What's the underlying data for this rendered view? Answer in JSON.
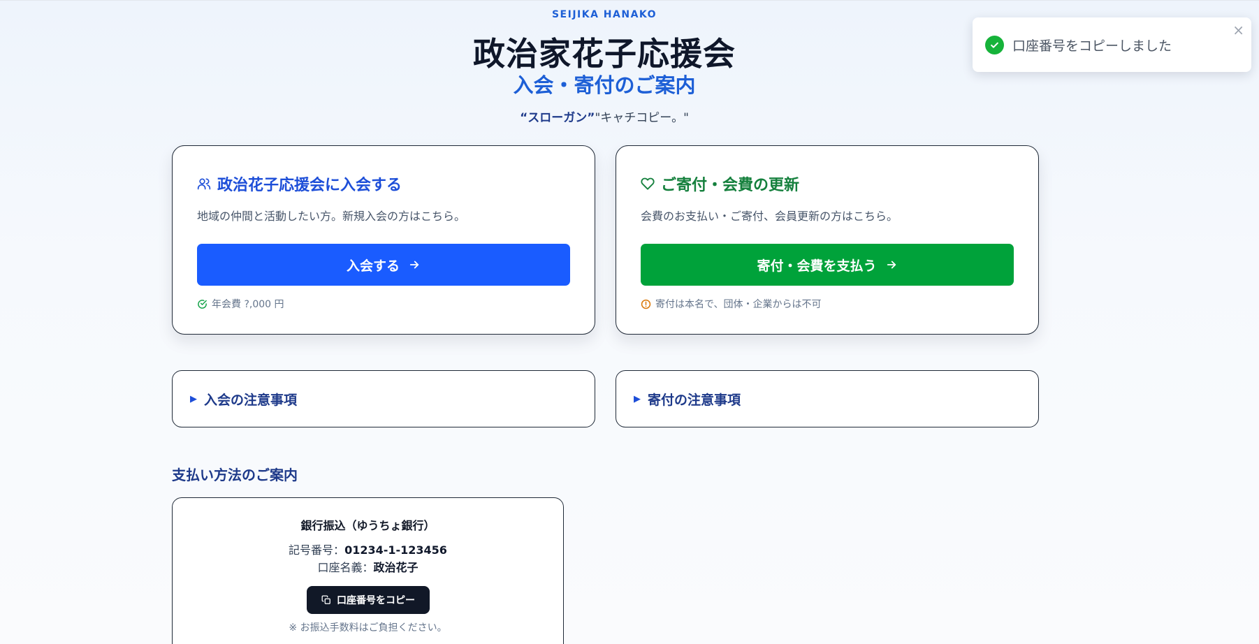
{
  "header": {
    "eyebrow": "SEIJIKA HANAKO",
    "title": "政治家花子応援会",
    "subtitle": "入会・寄付のご案内",
    "slogan_bold": "“スローガン”",
    "slogan_rest": "\"キャチコピー。\""
  },
  "cards": {
    "join": {
      "icon": "users-icon",
      "heading": "政治花子応援会に入会する",
      "description": "地域の仲間と活動したい方。新規入会の方はこちら。",
      "button_label": "入会する",
      "note": "年会費 ?,000 円",
      "accent": "#1a5cff"
    },
    "donate": {
      "icon": "heart-icon",
      "heading": "ご寄付・会費の更新",
      "description": "会費のお支払い・ご寄付、会員更新の方はこちら。",
      "button_label": "寄付・会費を支払う",
      "note": "寄付は本名で、団体・企業からは不可",
      "accent": "#00a23a"
    }
  },
  "accordions": [
    {
      "label": "入会の注意事項"
    },
    {
      "label": "寄付の注意事項"
    }
  ],
  "payment": {
    "section_title": "支払い方法のご案内",
    "bank_title": "銀行振込（ゆうちょ銀行）",
    "account_number_label": "記号番号：",
    "account_number": "01234-1-123456",
    "account_name_label": "口座名義：",
    "account_name": "政治花子",
    "copy_button": "口座番号をコピー",
    "fee_note": "※ お振込手数料はご負担ください。"
  },
  "toast": {
    "message": "口座番号をコピーしました",
    "close": "×"
  }
}
